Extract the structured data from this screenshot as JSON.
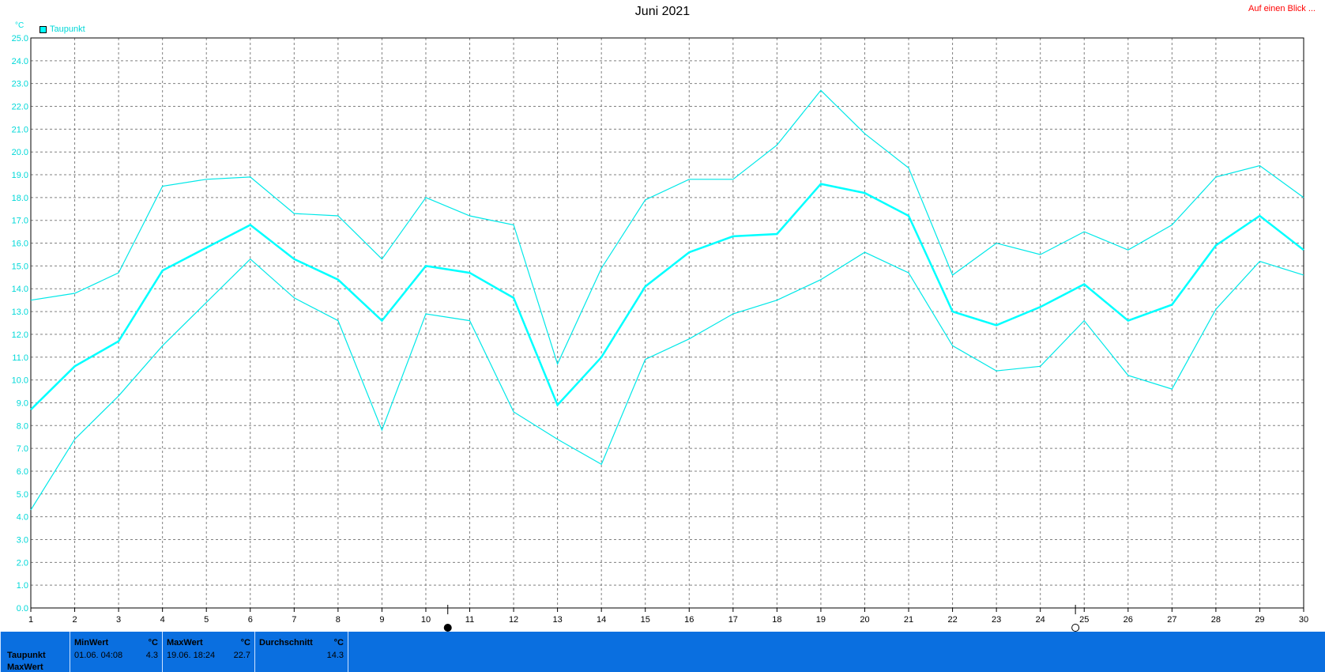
{
  "chart_data": {
    "type": "line",
    "title": "Juni 2021",
    "y_unit": "°C",
    "ylim": [
      0,
      25
    ],
    "y_ticks": [
      "0.0",
      "1.0",
      "2.0",
      "3.0",
      "4.0",
      "5.0",
      "6.0",
      "7.0",
      "8.0",
      "9.0",
      "10.0",
      "11.0",
      "12.0",
      "13.0",
      "14.0",
      "15.0",
      "16.0",
      "17.0",
      "18.0",
      "19.0",
      "20.0",
      "21.0",
      "22.0",
      "23.0",
      "24.0",
      "25.0"
    ],
    "x": [
      "1",
      "2",
      "3",
      "4",
      "5",
      "6",
      "7",
      "8",
      "9",
      "10",
      "11",
      "12",
      "13",
      "14",
      "15",
      "16",
      "17",
      "18",
      "19",
      "20",
      "21",
      "22",
      "23",
      "24",
      "25",
      "26",
      "27",
      "28",
      "29",
      "30"
    ],
    "grid": true,
    "legend": "top-left",
    "legend_label": "Taupunkt",
    "moon_markers": [
      {
        "day": 10.5,
        "phase": "new-moon-icon"
      },
      {
        "day": 24.8,
        "phase": "full-moon-icon"
      }
    ],
    "series": [
      {
        "name": "Taupunkt",
        "role": "max",
        "values": [
          13.5,
          13.8,
          14.7,
          18.5,
          18.8,
          18.9,
          17.3,
          17.2,
          15.3,
          18.0,
          17.2,
          16.8,
          10.7,
          14.9,
          17.9,
          18.8,
          18.8,
          20.3,
          22.7,
          20.8,
          19.3,
          14.6,
          16.0,
          15.5,
          16.5,
          15.7,
          16.8,
          18.9,
          19.4,
          18.0
        ],
        "color": "#00e8e8"
      },
      {
        "name": "Taupunkt",
        "role": "avg",
        "values": [
          8.7,
          10.6,
          11.7,
          14.8,
          15.8,
          16.8,
          15.3,
          14.4,
          12.6,
          15.0,
          14.7,
          13.6,
          8.9,
          11.0,
          14.1,
          15.6,
          16.3,
          16.4,
          18.6,
          18.2,
          17.2,
          13.0,
          12.4,
          13.2,
          14.2,
          12.6,
          13.3,
          15.9,
          17.2,
          15.7
        ],
        "color": "#00ffff"
      },
      {
        "name": "Taupunkt",
        "role": "min",
        "values": [
          4.3,
          7.4,
          9.3,
          11.5,
          13.4,
          15.3,
          13.6,
          12.6,
          7.8,
          12.9,
          12.6,
          8.6,
          7.4,
          6.3,
          10.9,
          11.8,
          12.9,
          13.5,
          14.4,
          15.6,
          14.7,
          11.5,
          10.4,
          10.6,
          12.6,
          10.2,
          9.6,
          13.1,
          15.2,
          14.6
        ],
        "color": "#00e8e8"
      }
    ]
  },
  "header": {
    "title": "Juni 2021",
    "corner_link": "Auf einen Blick ...",
    "unit": "°C",
    "legend_label": "Taupunkt"
  },
  "stats": {
    "row_label": "Taupunkt",
    "row_label_2": "MaxWert",
    "min": {
      "header": "MinWert",
      "unit": "°C",
      "when": "01.06.  04:08",
      "value": "4.3"
    },
    "max": {
      "header": "MaxWert",
      "unit": "°C",
      "when": "19.06.  18:24",
      "value": "22.7"
    },
    "avg": {
      "header": "Durchschnitt",
      "unit": "°C",
      "value": "14.3"
    }
  },
  "colors": {
    "grid": "#808080",
    "axis": "#000000",
    "series": "#00ffff",
    "bar": "#0a6fe0",
    "link": "#ff0000"
  }
}
